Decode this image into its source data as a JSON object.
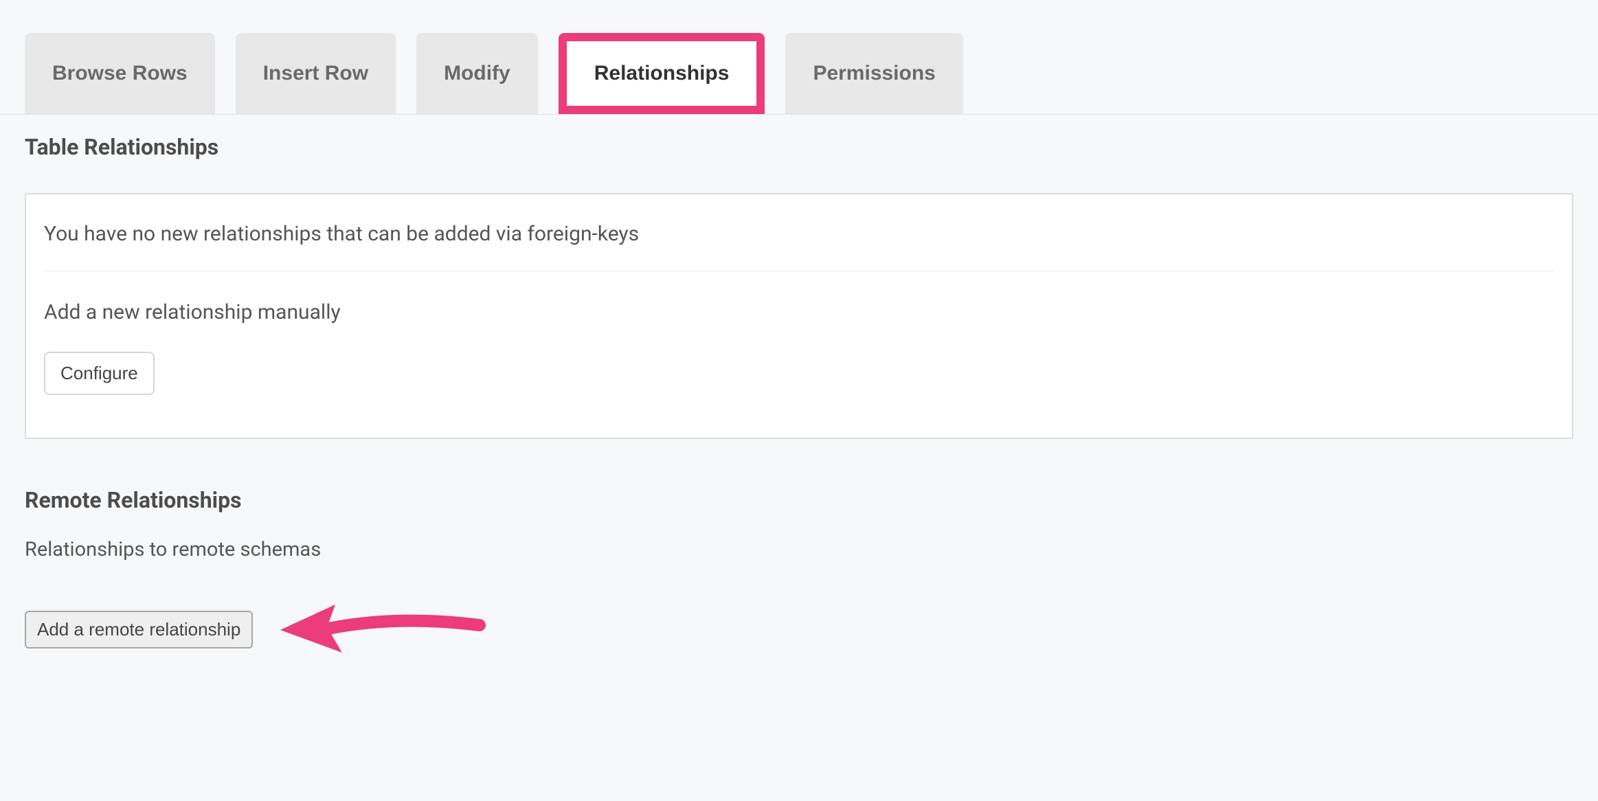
{
  "tabs": {
    "browse": "Browse Rows",
    "insert": "Insert Row",
    "modify": "Modify",
    "relationships": "Relationships",
    "permissions": "Permissions"
  },
  "section": {
    "table_relationships_title": "Table Relationships",
    "no_new_text": "You have no new relationships that can be added via foreign-keys",
    "add_manual_text": "Add a new relationship manually",
    "configure_button": "Configure"
  },
  "remote": {
    "title": "Remote Relationships",
    "subtext": "Relationships to remote schemas",
    "add_button": "Add a remote relationship"
  },
  "annotation": {
    "highlight_color": "#ec3c7a",
    "arrow_color": "#ec3c7a"
  }
}
